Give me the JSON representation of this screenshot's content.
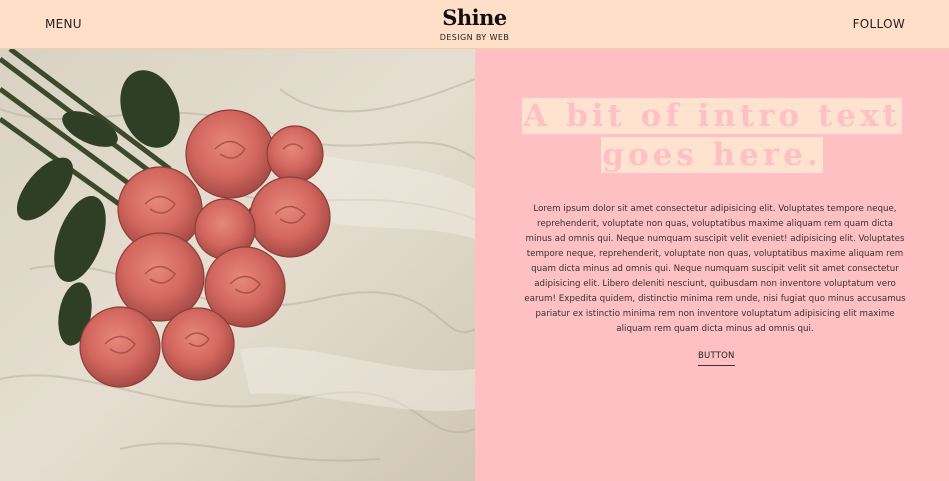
{
  "header": {
    "menu_label": "MENU",
    "logo": "Shine",
    "tagline": "DESIGN BY WEB",
    "follow_label": "FOLLOW"
  },
  "hero": {
    "image_icon": "roses-photo",
    "title": "A bit of intro text goes here.",
    "body": "Lorem ipsum dolor sit amet consectetur adipisicing elit. Voluptates tempore neque, reprehenderit, voluptate non quas, voluptatibus maxime aliquam rem quam dicta minus ad omnis qui. Neque numquam suscipit velit eveniet! adipisicing elit. Voluptates tempore neque, reprehenderit, voluptate non quas, voluptatibus maxime aliquam rem quam dicta minus ad omnis qui. Neque numquam suscipit velit sit amet consectetur adipisicing elit. Libero deleniti nesciunt, quibusdam non inventore voluptatum vero earum! Expedita quidem, distinctio minima rem unde, nisi fugiat quo minus accusamus pariatur ex istinctio minima rem non inventore voluptatum adipisicing elit maxime aliquam rem quam dicta minus ad omnis qui.",
    "button_label": "BUTTON"
  },
  "colors": {
    "header_bg": "#ffdfc7",
    "page_bg": "#ffc0c4",
    "title_highlight": "#ffe2cf"
  }
}
